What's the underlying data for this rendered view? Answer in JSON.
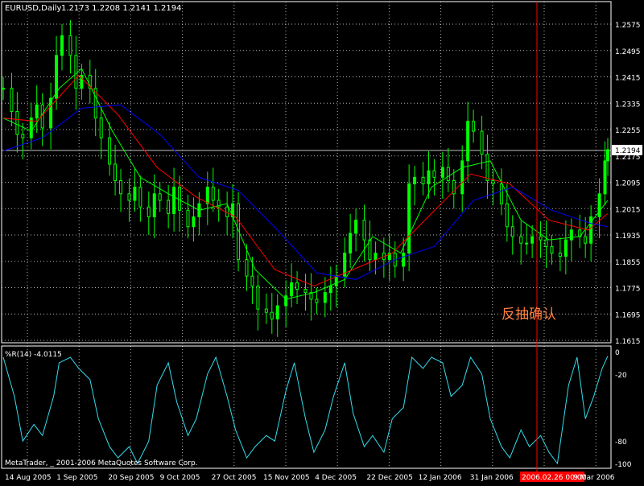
{
  "header": {
    "symbol_label": "EURUSD,Daily",
    "ohlc": "1.2173 1.2208 1.2141 1.2194"
  },
  "price_axis": {
    "ticks": [
      "1.2575",
      "1.2495",
      "1.2415",
      "1.2335",
      "1.2255",
      "1.2175",
      "1.2095",
      "1.2015",
      "1.1935",
      "1.1855",
      "1.1775",
      "1.1695",
      "1.1615"
    ],
    "current_price_label": "1.2194"
  },
  "indicator": {
    "title": "%R(14) -4.0115",
    "ticks": [
      "0",
      "-20",
      "-80",
      "-100"
    ]
  },
  "annotation": {
    "text": "反抽确认"
  },
  "copyright": "MetaTrader, _ 2001-2006 MetaQuotes Software Corp.",
  "time_axis": {
    "labels": [
      "14 Aug 2005",
      "1 Sep 2005",
      "20 Sep 2005",
      "9 Oct 2005",
      "27 Oct 2005",
      "15 Nov 2005",
      "4 Dec 2005",
      "22 Dec 2005",
      "12 Jan 2006",
      "31 Jan 2006",
      "2006.02.26 00:00",
      "9 Mar 2006"
    ],
    "highlighted_label": "2006.02.26 00:00"
  },
  "colors": {
    "background": "#000000",
    "grid": "#d8d8d8",
    "candle": "#00ff00",
    "ma_fast": "#00ff00",
    "ma_mid": "#ff0000",
    "ma_slow": "#0000ff",
    "williams_r": "#33ddee",
    "cursor_line": "#ff0000",
    "annotation": "#ff8040"
  },
  "chart_data": [
    {
      "type": "candlestick",
      "title": "EURUSD,Daily",
      "ylim": [
        1.1615,
        1.2575
      ],
      "close_series": [
        [
          "2005-08-12",
          1.238
        ],
        [
          "2005-08-15",
          1.231
        ],
        [
          "2005-08-17",
          1.224
        ],
        [
          "2005-08-19",
          1.223
        ],
        [
          "2005-08-22",
          1.229
        ],
        [
          "2005-08-24",
          1.233
        ],
        [
          "2005-08-26",
          1.226
        ],
        [
          "2005-08-29",
          1.235
        ],
        [
          "2005-08-31",
          1.248
        ],
        [
          "2005-09-02",
          1.254
        ],
        [
          "2005-09-05",
          1.248
        ],
        [
          "2005-09-07",
          1.238
        ],
        [
          "2005-09-09",
          1.242
        ],
        [
          "2005-09-12",
          1.238
        ],
        [
          "2005-09-14",
          1.229
        ],
        [
          "2005-09-16",
          1.223
        ],
        [
          "2005-09-19",
          1.215
        ],
        [
          "2005-09-21",
          1.21
        ],
        [
          "2005-09-23",
          1.206
        ],
        [
          "2005-09-26",
          1.204
        ],
        [
          "2005-09-28",
          1.208
        ],
        [
          "2005-09-30",
          1.202
        ],
        [
          "2005-10-03",
          1.199
        ],
        [
          "2005-10-05",
          1.206
        ],
        [
          "2005-10-07",
          1.204
        ],
        [
          "2005-10-10",
          1.2
        ],
        [
          "2005-10-12",
          1.208
        ],
        [
          "2005-10-14",
          1.201
        ],
        [
          "2005-10-17",
          1.196
        ],
        [
          "2005-10-19",
          1.199
        ],
        [
          "2005-10-21",
          1.203
        ],
        [
          "2005-10-24",
          1.208
        ],
        [
          "2005-10-26",
          1.204
        ],
        [
          "2005-10-28",
          1.202
        ],
        [
          "2005-10-31",
          1.199
        ],
        [
          "2005-11-02",
          1.203
        ],
        [
          "2005-11-04",
          1.186
        ],
        [
          "2005-11-07",
          1.181
        ],
        [
          "2005-11-09",
          1.178
        ],
        [
          "2005-11-11",
          1.171
        ],
        [
          "2005-11-14",
          1.17
        ],
        [
          "2005-11-16",
          1.168
        ],
        [
          "2005-11-18",
          1.172
        ],
        [
          "2005-11-21",
          1.175
        ],
        [
          "2005-11-23",
          1.179
        ],
        [
          "2005-11-25",
          1.177
        ],
        [
          "2005-11-28",
          1.176
        ],
        [
          "2005-11-30",
          1.174
        ],
        [
          "2005-12-02",
          1.173
        ],
        [
          "2005-12-05",
          1.176
        ],
        [
          "2005-12-07",
          1.178
        ],
        [
          "2005-12-09",
          1.181
        ],
        [
          "2005-12-12",
          1.188
        ],
        [
          "2005-12-14",
          1.194
        ],
        [
          "2005-12-16",
          1.198
        ],
        [
          "2005-12-19",
          1.192
        ],
        [
          "2005-12-21",
          1.186
        ],
        [
          "2005-12-23",
          1.188
        ],
        [
          "2005-12-26",
          1.186
        ],
        [
          "2005-12-28",
          1.188
        ],
        [
          "2005-12-30",
          1.184
        ],
        [
          "2006-01-02",
          1.188
        ],
        [
          "2006-01-04",
          1.209
        ],
        [
          "2006-01-06",
          1.211
        ],
        [
          "2006-01-09",
          1.209
        ],
        [
          "2006-01-11",
          1.213
        ],
        [
          "2006-01-13",
          1.211
        ],
        [
          "2006-01-16",
          1.214
        ],
        [
          "2006-01-18",
          1.21
        ],
        [
          "2006-01-20",
          1.206
        ],
        [
          "2006-01-23",
          1.216
        ],
        [
          "2006-01-25",
          1.228
        ],
        [
          "2006-01-27",
          1.225
        ],
        [
          "2006-01-30",
          1.218
        ],
        [
          "2006-02-01",
          1.21
        ],
        [
          "2006-02-03",
          1.209
        ],
        [
          "2006-02-06",
          1.203
        ],
        [
          "2006-02-08",
          1.196
        ],
        [
          "2006-02-10",
          1.193
        ],
        [
          "2006-02-13",
          1.191
        ],
        [
          "2006-02-15",
          1.191
        ],
        [
          "2006-02-17",
          1.193
        ],
        [
          "2006-02-20",
          1.192
        ],
        [
          "2006-02-22",
          1.19
        ],
        [
          "2006-02-24",
          1.188
        ],
        [
          "2006-02-27",
          1.187
        ],
        [
          "2006-03-01",
          1.192
        ],
        [
          "2006-03-03",
          1.195
        ],
        [
          "2006-03-06",
          1.193
        ],
        [
          "2006-03-08",
          1.191
        ],
        [
          "2006-03-10",
          1.199
        ],
        [
          "2006-03-13",
          1.206
        ],
        [
          "2006-03-15",
          1.216
        ],
        [
          "2006-03-16",
          1.2194
        ]
      ],
      "moving_averages": [
        {
          "name": "",
          "color": "#00ff00",
          "values": [
            [
              "2005-08-12",
              1.229
            ],
            [
              "2005-08-22",
              1.225
            ],
            [
              "2005-09-01",
              1.238
            ],
            [
              "2005-09-09",
              1.244
            ],
            [
              "2005-09-20",
              1.225
            ],
            [
              "2005-09-30",
              1.211
            ],
            [
              "2005-10-10",
              1.206
            ],
            [
              "2005-10-21",
              1.201
            ],
            [
              "2005-10-31",
              1.203
            ],
            [
              "2005-11-10",
              1.183
            ],
            [
              "2005-11-21",
              1.174
            ],
            [
              "2005-12-01",
              1.176
            ],
            [
              "2005-12-12",
              1.18
            ],
            [
              "2005-12-22",
              1.193
            ],
            [
              "2006-01-01",
              1.188
            ],
            [
              "2006-01-12",
              1.208
            ],
            [
              "2006-01-23",
              1.214
            ],
            [
              "2006-02-02",
              1.216
            ],
            [
              "2006-02-13",
              1.198
            ],
            [
              "2006-02-23",
              1.192
            ],
            [
              "2006-03-06",
              1.193
            ],
            [
              "2006-03-16",
              1.204
            ]
          ]
        },
        {
          "name": "",
          "color": "#ff0000",
          "values": [
            [
              "2005-08-12",
              1.229
            ],
            [
              "2005-08-24",
              1.228
            ],
            [
              "2005-09-08",
              1.242
            ],
            [
              "2005-09-22",
              1.23
            ],
            [
              "2005-10-06",
              1.214
            ],
            [
              "2005-10-20",
              1.205
            ],
            [
              "2005-11-03",
              1.199
            ],
            [
              "2005-11-17",
              1.183
            ],
            [
              "2005-12-01",
              1.178
            ],
            [
              "2005-12-15",
              1.183
            ],
            [
              "2005-12-29",
              1.188
            ],
            [
              "2006-01-12",
              1.2
            ],
            [
              "2006-01-26",
              1.212
            ],
            [
              "2006-02-09",
              1.209
            ],
            [
              "2006-02-23",
              1.198
            ],
            [
              "2006-03-09",
              1.195
            ],
            [
              "2006-03-16",
              1.2
            ]
          ]
        },
        {
          "name": "",
          "color": "#0000ff",
          "values": [
            [
              "2005-08-12",
              1.219
            ],
            [
              "2005-08-26",
              1.223
            ],
            [
              "2005-09-09",
              1.232
            ],
            [
              "2005-09-23",
              1.233
            ],
            [
              "2005-10-07",
              1.224
            ],
            [
              "2005-10-21",
              1.211
            ],
            [
              "2005-11-04",
              1.207
            ],
            [
              "2005-11-18",
              1.195
            ],
            [
              "2005-12-02",
              1.182
            ],
            [
              "2005-12-16",
              1.18
            ],
            [
              "2005-12-30",
              1.186
            ],
            [
              "2006-01-13",
              1.19
            ],
            [
              "2006-01-27",
              1.204
            ],
            [
              "2006-02-10",
              1.208
            ],
            [
              "2006-02-24",
              1.201
            ],
            [
              "2006-03-10",
              1.197
            ],
            [
              "2006-03-16",
              1.196
            ]
          ]
        }
      ]
    },
    {
      "type": "line",
      "title": "%R(14) -4.0115",
      "ylim": [
        -100,
        0
      ],
      "series": [
        {
          "name": "%R(14)",
          "values": [
            [
              "2005-08-12",
              -5
            ],
            [
              "2005-08-16",
              -40
            ],
            [
              "2005-08-19",
              -80
            ],
            [
              "2005-08-23",
              -65
            ],
            [
              "2005-08-26",
              -75
            ],
            [
              "2005-08-30",
              -40
            ],
            [
              "2005-09-01",
              -10
            ],
            [
              "2005-09-05",
              -5
            ],
            [
              "2005-09-08",
              -15
            ],
            [
              "2005-09-12",
              -25
            ],
            [
              "2005-09-15",
              -60
            ],
            [
              "2005-09-19",
              -85
            ],
            [
              "2005-09-22",
              -95
            ],
            [
              "2005-09-26",
              -85
            ],
            [
              "2005-09-29",
              -100
            ],
            [
              "2005-10-03",
              -80
            ],
            [
              "2005-10-06",
              -30
            ],
            [
              "2005-10-10",
              -10
            ],
            [
              "2005-10-13",
              -45
            ],
            [
              "2005-10-17",
              -75
            ],
            [
              "2005-10-20",
              -60
            ],
            [
              "2005-10-24",
              -20
            ],
            [
              "2005-10-27",
              -5
            ],
            [
              "2005-10-31",
              -40
            ],
            [
              "2005-11-03",
              -70
            ],
            [
              "2005-11-07",
              -95
            ],
            [
              "2005-11-10",
              -85
            ],
            [
              "2005-11-14",
              -75
            ],
            [
              "2005-11-17",
              -80
            ],
            [
              "2005-11-21",
              -35
            ],
            [
              "2005-11-24",
              -10
            ],
            [
              "2005-11-28",
              -60
            ],
            [
              "2005-12-01",
              -90
            ],
            [
              "2005-12-05",
              -70
            ],
            [
              "2005-12-08",
              -40
            ],
            [
              "2005-12-12",
              -10
            ],
            [
              "2005-12-15",
              -55
            ],
            [
              "2005-12-19",
              -85
            ],
            [
              "2005-12-22",
              -75
            ],
            [
              "2005-12-26",
              -90
            ],
            [
              "2005-12-29",
              -60
            ],
            [
              "2006-01-02",
              -50
            ],
            [
              "2006-01-05",
              -5
            ],
            [
              "2006-01-09",
              -15
            ],
            [
              "2006-01-12",
              -5
            ],
            [
              "2006-01-16",
              -10
            ],
            [
              "2006-01-19",
              -40
            ],
            [
              "2006-01-23",
              -30
            ],
            [
              "2006-01-26",
              -5
            ],
            [
              "2006-01-30",
              -20
            ],
            [
              "2006-02-02",
              -60
            ],
            [
              "2006-02-06",
              -85
            ],
            [
              "2006-02-09",
              -95
            ],
            [
              "2006-02-13",
              -70
            ],
            [
              "2006-02-16",
              -85
            ],
            [
              "2006-02-20",
              -75
            ],
            [
              "2006-02-23",
              -90
            ],
            [
              "2006-02-26",
              -100
            ],
            [
              "2006-03-02",
              -30
            ],
            [
              "2006-03-05",
              -5
            ],
            [
              "2006-03-08",
              -60
            ],
            [
              "2006-03-11",
              -40
            ],
            [
              "2006-03-14",
              -15
            ],
            [
              "2006-03-16",
              -4.0115
            ]
          ]
        }
      ]
    }
  ]
}
